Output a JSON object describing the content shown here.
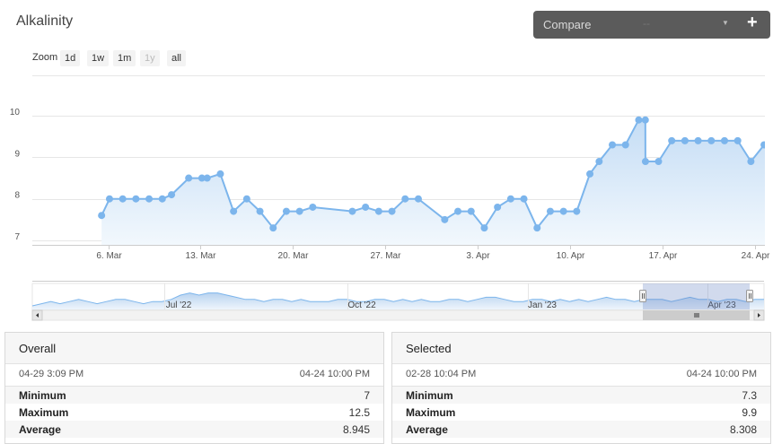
{
  "title": "Alkalinity",
  "compare": {
    "label": "Compare",
    "value": "--"
  },
  "zoom": {
    "label": "Zoom",
    "buttons": [
      "1d",
      "1w",
      "1m",
      "1y",
      "all"
    ]
  },
  "chart_data": {
    "type": "area",
    "title": "Alkalinity",
    "ylim": [
      7,
      10
    ],
    "y_ticks": [
      7,
      8,
      9,
      10
    ],
    "x_ticks": [
      "6. Mar",
      "13. Mar",
      "20. Mar",
      "27. Mar",
      "3. Apr",
      "10. Apr",
      "17. Apr",
      "24. Apr"
    ],
    "series": [
      {
        "x": [
          -0.5,
          0.1,
          1.1,
          2.1,
          3.1,
          4.1,
          4.8,
          6.1,
          7.1,
          7.5,
          8.5,
          9.5,
          10.5,
          11.5,
          12.5,
          13.5,
          14.5,
          15.5,
          18.5,
          19.5,
          20.5,
          21.5,
          22.5,
          23.5,
          25.5,
          26.5,
          27.5,
          28.5,
          29.5,
          30.5,
          31.5,
          32.5,
          33.5,
          34.5,
          35.5,
          36.5,
          37.2,
          38.2,
          39.2,
          40.2,
          40.7,
          40.71,
          41.7,
          42.7,
          43.7,
          44.7,
          45.7,
          46.7,
          47.7,
          48.7,
          49.7,
          50.7,
          51.7,
          52.7,
          53.3
        ],
        "y": [
          7.6,
          8.0,
          8.0,
          8.0,
          8.0,
          8.0,
          8.1,
          8.5,
          8.5,
          8.5,
          8.6,
          7.7,
          8.0,
          7.7,
          7.3,
          7.7,
          7.7,
          7.8,
          7.7,
          7.8,
          7.7,
          7.7,
          8.0,
          8.0,
          7.5,
          7.7,
          7.7,
          7.3,
          7.8,
          8.0,
          8.0,
          7.3,
          7.7,
          7.7,
          7.7,
          8.6,
          8.9,
          9.3,
          9.3,
          9.9,
          9.9,
          8.9,
          8.9,
          9.4,
          9.4,
          9.4,
          9.4,
          9.4,
          9.4,
          8.9,
          9.3,
          9.3,
          9.3,
          9.3,
          9.1
        ],
        "marker": true
      }
    ],
    "navigator": {
      "labels": [
        "Jul '22",
        "Oct '22",
        "Jan '23",
        "Apr '23"
      ]
    }
  },
  "colors": {
    "line": "#7cb5ec",
    "fill_top": "#c5ddf5",
    "fill_bottom": "#f2f8fd",
    "navigator_mask": "rgba(102,133,194,0.3)"
  },
  "overall": {
    "title": "Overall",
    "start": "04-29 3:09 PM",
    "end": "04-24 10:00 PM",
    "stats": [
      {
        "label": "Minimum",
        "value": "7"
      },
      {
        "label": "Maximum",
        "value": "12.5"
      },
      {
        "label": "Average",
        "value": "8.945"
      }
    ]
  },
  "selected": {
    "title": "Selected",
    "start": "02-28 10:04 PM",
    "end": "04-24 10:00 PM",
    "stats": [
      {
        "label": "Minimum",
        "value": "7.3"
      },
      {
        "label": "Maximum",
        "value": "9.9"
      },
      {
        "label": "Average",
        "value": "8.308"
      }
    ]
  }
}
